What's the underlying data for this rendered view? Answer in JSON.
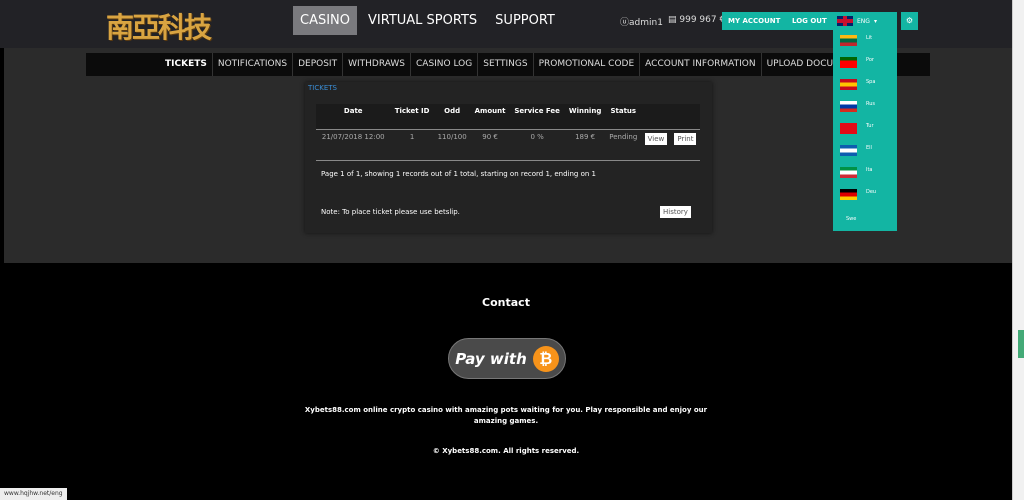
{
  "header": {
    "logo_text": "南亞科技",
    "nav": [
      {
        "label": "CASINO",
        "active": true
      },
      {
        "label": "VIRTUAL SPORTS"
      },
      {
        "label": "SUPPORT"
      }
    ],
    "user": "admin1",
    "balance": "999 967 €",
    "my_account": "MY ACCOUNT",
    "logout": "LOG OUT",
    "language": "ENG",
    "accent": "#13b5a3"
  },
  "languages": [
    {
      "label": "Lit",
      "colors": [
        "#fdb913",
        "#006a44",
        "#c1272d"
      ]
    },
    {
      "label": "Por",
      "colors": [
        "#006600",
        "#ff0000",
        "#ff0000"
      ]
    },
    {
      "label": "Spa",
      "colors": [
        "#c60b1e",
        "#ffc400",
        "#c60b1e"
      ]
    },
    {
      "label": "Rus",
      "colors": [
        "#ffffff",
        "#0039a6",
        "#d52b1e"
      ]
    },
    {
      "label": "Tur",
      "colors": [
        "#e30a17",
        "#e30a17",
        "#e30a17"
      ]
    },
    {
      "label": "Ell",
      "colors": [
        "#0d5eaf",
        "#ffffff",
        "#0d5eaf"
      ]
    },
    {
      "label": "Ita",
      "colors": [
        "#009246",
        "#ffffff",
        "#ce2b37"
      ]
    },
    {
      "label": "Deu",
      "colors": [
        "#000000",
        "#dd0000",
        "#ffce00"
      ]
    },
    {
      "label": "Swe"
    }
  ],
  "subnav": [
    {
      "label": "TICKETS",
      "active": true
    },
    {
      "label": "NOTIFICATIONS"
    },
    {
      "label": "DEPOSIT"
    },
    {
      "label": "WITHDRAWS"
    },
    {
      "label": "CASINO LOG"
    },
    {
      "label": "SETTINGS"
    },
    {
      "label": "PROMOTIONAL CODE"
    },
    {
      "label": "ACCOUNT INFORMATION"
    },
    {
      "label": "UPLOAD DOCUMENTATION"
    }
  ],
  "tickets": {
    "title": "TICKETS",
    "columns": [
      "Date",
      "Ticket ID",
      "Odd",
      "Amount",
      "Service Fee",
      "Winning",
      "Status"
    ],
    "rows": [
      {
        "date": "21/07/2018 12:00",
        "id": "1",
        "odd": "110/100",
        "amount": "90 €",
        "fee": "0 %",
        "winning": "189 €",
        "status": "Pending",
        "view": "View",
        "print": "Print"
      }
    ],
    "page_info": "Page 1 of 1, showing 1 records out of 1 total, starting on record 1, ending on 1",
    "note": "Note: To place ticket please use betslip.",
    "history": "History"
  },
  "footer": {
    "contact": "Contact",
    "pay_with": "Pay with",
    "description": "Xybets88.com online crypto casino with amazing pots waiting for you. Play responsible and enjoy our amazing games.",
    "copyright": "© Xybets88.com. All rights reserved."
  },
  "status_url": "www.hqjhw.net/eng"
}
